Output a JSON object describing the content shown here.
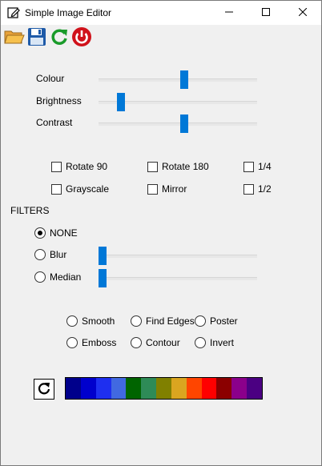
{
  "window": {
    "title": "Simple Image Editor"
  },
  "toolbar": {
    "open_icon": "folder-open-icon",
    "save_icon": "floppy-save-icon",
    "refresh_icon": "refresh-icon",
    "power_icon": "power-icon"
  },
  "sliders": [
    {
      "label": "Colour",
      "level": 0.54
    },
    {
      "label": "Brightness",
      "level": 0.12
    },
    {
      "label": "Contrast",
      "level": 0.54
    }
  ],
  "checkboxes": {
    "rotate90": "Rotate 90",
    "rotate180": "Rotate 180",
    "quarter": "1/4",
    "grayscale": "Grayscale",
    "mirror": "Mirror",
    "half": "1/2"
  },
  "filters": {
    "heading": "FILTERS",
    "none": "NONE",
    "blur": "Blur",
    "median": "Median",
    "blur_level": 0.0,
    "median_level": 0.0,
    "selected": "NONE"
  },
  "effects": {
    "smooth": "Smooth",
    "find_edges": "Find Edges",
    "poster": "Poster",
    "emboss": "Emboss",
    "contour": "Contour",
    "invert": "Invert"
  },
  "palette": [
    "#00008b",
    "#0000cd",
    "#1e2ff0",
    "#4169e1",
    "#006400",
    "#2e8b57",
    "#808000",
    "#daa520",
    "#ff4500",
    "#ff0000",
    "#8b0000",
    "#8b008b",
    "#4b0082"
  ]
}
